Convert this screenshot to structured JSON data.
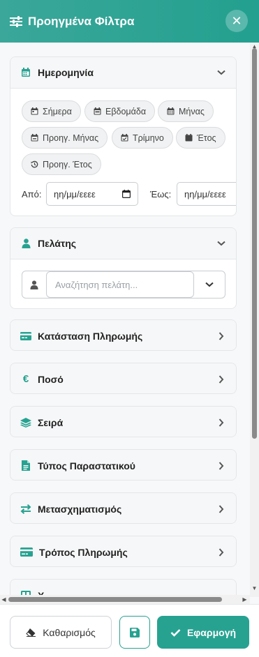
{
  "header": {
    "title": "Προηγμένα Φίλτρα",
    "close_label": "✕"
  },
  "date_section": {
    "title": "Ημερομηνία",
    "chips": [
      "Σήμερα",
      "Εβδομάδα",
      "Μήνας",
      "Προηγ. Μήνας",
      "Τρίμηνο",
      "Έτος",
      "Προηγ. Έτος"
    ],
    "from_label": "Από:",
    "to_label": "Έως:",
    "from_value": "ηη/μμ/εεεε",
    "to_value": "ηη/μμ/εεεε"
  },
  "customer_section": {
    "title": "Πελάτης",
    "search_placeholder": "Αναζήτηση πελάτη..."
  },
  "sections": [
    {
      "label": "Κατάσταση Πληρωμής",
      "icon": "card-icon"
    },
    {
      "label": "Ποσό",
      "icon": "euro-icon"
    },
    {
      "label": "Σειρά",
      "icon": "layers-icon"
    },
    {
      "label": "Τύπος Παραστατικού",
      "icon": "file-icon"
    },
    {
      "label": "Μετασχηματισμός",
      "icon": "exchange-icon"
    },
    {
      "label": "Τρόπος Πληρωμής",
      "icon": "credit-card-icon"
    },
    {
      "label": "Χ...",
      "icon": "table-icon"
    }
  ],
  "footer": {
    "clear_label": "Καθαρισμός",
    "apply_label": "Εφαρμογή"
  },
  "colors": {
    "accent": "#27a291",
    "header": "#2ba394"
  }
}
